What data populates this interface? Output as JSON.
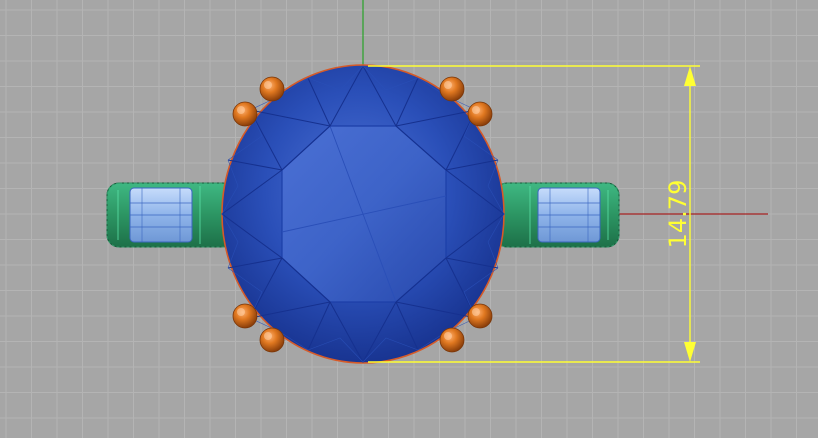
{
  "viewport": {
    "background": "#a6a6a6",
    "grid_color": "#b4b4b4",
    "grid_major_color": "#bdbdbd"
  },
  "axes": {
    "y_axis_color": "#29a329",
    "x_axis_color": "#a82424"
  },
  "model": {
    "gem_color": "#1f3ea6",
    "gem_edge_color": "#d65a28",
    "prong_color": "#e07820",
    "band_color": "#2f9a66",
    "setting_glass_color": "#8fb4ea"
  },
  "dimension": {
    "value": "14.79",
    "color": "#ffff33"
  }
}
